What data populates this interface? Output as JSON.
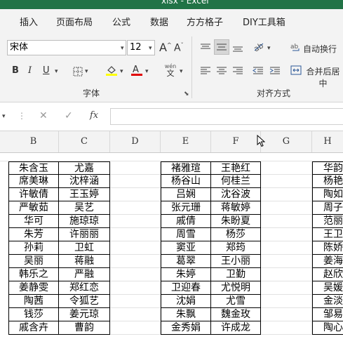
{
  "titlebar": {
    "text": "xlsx  -  Excel"
  },
  "menu": [
    "插入",
    "页面布局",
    "公式",
    "数据",
    "方方格子",
    "DIY工具箱"
  ],
  "ribbon": {
    "font_name": "宋体",
    "font_size": "12",
    "grow_label": "A",
    "shrink_label": "A",
    "bold": "B",
    "italic": "I",
    "underline": "U",
    "wen_label": "wén",
    "wrap_text": "自动换行",
    "merge_center": "合并后居中",
    "font_group": "字体",
    "align_group": "对齐方式"
  },
  "formula_bar": {
    "fx": "fx",
    "cancel": "✕",
    "confirm": "✓",
    "value": ""
  },
  "columns": [
    "B",
    "C",
    "D",
    "E",
    "F",
    "G",
    "H"
  ],
  "table": {
    "rows": [
      [
        "朱含玉",
        "尤嘉",
        "",
        "褚雅瑄",
        "王艳红",
        "",
        "华韵"
      ],
      [
        "席美琳",
        "沈梓涵",
        "",
        "杨谷山",
        "何桂兰",
        "",
        "杨艳"
      ],
      [
        "许敏倩",
        "王玉婷",
        "",
        "吕娴",
        "沈谷波",
        "",
        "陶如"
      ],
      [
        "严敏茹",
        "吴艺",
        "",
        "张元珊",
        "蒋敏婷",
        "",
        "周子"
      ],
      [
        "华可",
        "施琼琼",
        "",
        "戚倩",
        "朱盼夏",
        "",
        "范丽"
      ],
      [
        "朱芳",
        "许丽丽",
        "",
        "周雪",
        "杨莎",
        "",
        "王卫"
      ],
      [
        "孙莉",
        "卫虹",
        "",
        "窦亚",
        "郑筠",
        "",
        "陈娇"
      ],
      [
        "吴丽",
        "蒋融",
        "",
        "葛翠",
        "王小丽",
        "",
        "姜海"
      ],
      [
        "韩乐之",
        "严融",
        "",
        "朱婷",
        "卫勤",
        "",
        "赵欣"
      ],
      [
        "姜静雯",
        "郑红恋",
        "",
        "卫迎春",
        "尤悦明",
        "",
        "吴媛"
      ],
      [
        "陶茜",
        "令狐艺",
        "",
        "沈娟",
        "尤雪",
        "",
        "金淡"
      ],
      [
        "钱莎",
        "姜元琼",
        "",
        "朱飘",
        "魏金玫",
        "",
        "邹易"
      ],
      [
        "戚含卉",
        "曹韵",
        "",
        "金秀娟",
        "许成龙",
        "",
        "陶心"
      ]
    ]
  }
}
